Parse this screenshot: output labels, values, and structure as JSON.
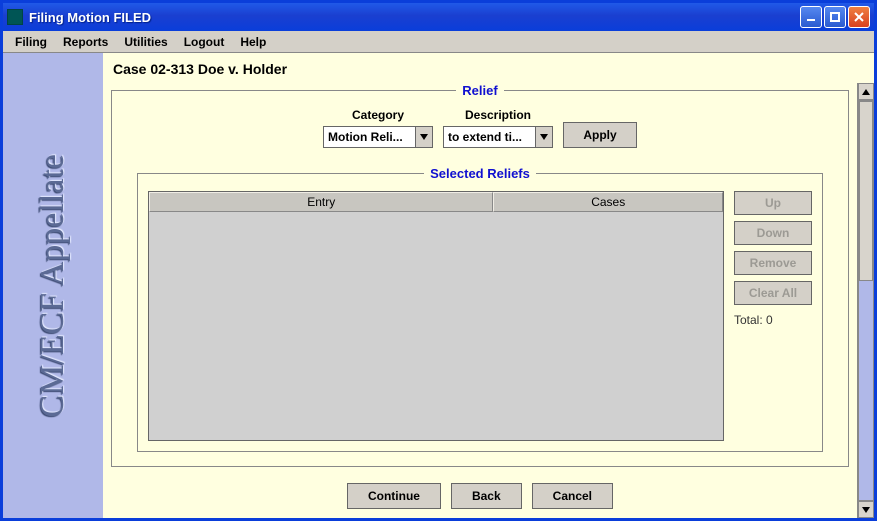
{
  "window": {
    "title": "Filing Motion FILED"
  },
  "menubar": {
    "items": [
      "Filing",
      "Reports",
      "Utilities",
      "Logout",
      "Help"
    ]
  },
  "sidebar": {
    "logo": "CM/ECF Appellate"
  },
  "case_header": "Case 02-313 Doe v. Holder",
  "relief": {
    "legend": "Relief",
    "category_label": "Category",
    "category_value": "Motion Reli...",
    "description_label": "Description",
    "description_value": "to extend ti...",
    "apply_label": "Apply"
  },
  "selected": {
    "legend": "Selected Reliefs",
    "col_entry": "Entry",
    "col_cases": "Cases",
    "up_label": "Up",
    "down_label": "Down",
    "remove_label": "Remove",
    "clearall_label": "Clear All",
    "total_label": "Total: 0"
  },
  "footer": {
    "continue_label": "Continue",
    "back_label": "Back",
    "cancel_label": "Cancel"
  }
}
